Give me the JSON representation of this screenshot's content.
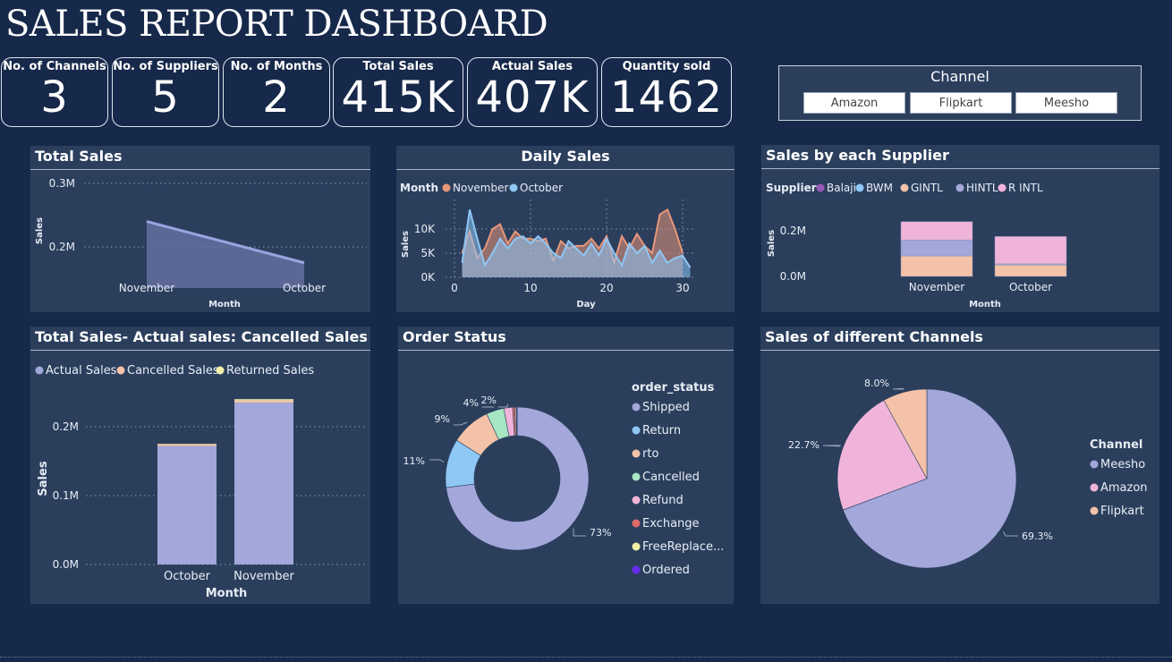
{
  "title": "SALES REPORT DASHBOARD",
  "cards": [
    {
      "label": "No. of Channels",
      "value": "3"
    },
    {
      "label": "No. of Suppliers",
      "value": "5"
    },
    {
      "label": "No. of Months",
      "value": "2"
    },
    {
      "label": "Total Sales",
      "value": "415K"
    },
    {
      "label": "Actual Sales",
      "value": "407K"
    },
    {
      "label": "Quantity sold",
      "value": "1462"
    }
  ],
  "slicer": {
    "title": "Channel",
    "options": [
      "Amazon",
      "Flipkart",
      "Meesho"
    ]
  },
  "colors": {
    "november": "#e8967a",
    "october": "#8fc7f5",
    "area": "#6470a0",
    "bar": "#a3a7da",
    "balaji": "#9b59b6",
    "bwm": "#8fc7f5",
    "gintl": "#f4c2a8",
    "hintl": "#a3a7da",
    "rintl": "#f0b4da",
    "shipped": "#a3a7da",
    "return": "#8fc7f5",
    "rto": "#f4c2a8",
    "cancelled": "#a7e6c3",
    "refund": "#f0b4da",
    "exchange": "#e06a6a",
    "freereplace": "#f2f0a8",
    "ordered": "#6a2cf0"
  },
  "chart_data": [
    {
      "id": "total-sales",
      "type": "area",
      "title": "Total Sales",
      "xlabel": "Month",
      "ylabel": "Sales",
      "categories": [
        "November",
        "October"
      ],
      "values": [
        240000,
        175000
      ],
      "y_ticks": [
        "0.2M",
        "0.3M"
      ],
      "ylim": [
        150000,
        300000
      ],
      "grid": true
    },
    {
      "id": "daily-sales",
      "type": "area",
      "title": "Daily Sales",
      "xlabel": "Day",
      "ylabel": "Sales",
      "legend_title": "Month",
      "x_ticks": [
        "0",
        "10",
        "20",
        "30"
      ],
      "y_ticks": [
        "0K",
        "5K",
        "10K"
      ],
      "ylim": [
        0,
        15000
      ],
      "xlim": [
        0,
        32
      ],
      "series": [
        {
          "name": "November",
          "x": [
            1,
            2,
            3,
            4,
            5,
            6,
            7,
            8,
            9,
            10,
            11,
            12,
            13,
            14,
            15,
            16,
            17,
            18,
            19,
            20,
            21,
            22,
            23,
            24,
            25,
            26,
            27,
            28,
            29,
            30
          ],
          "values": [
            5000,
            9500,
            4000,
            6000,
            10000,
            11000,
            7000,
            9500,
            8000,
            8000,
            7500,
            8000,
            3500,
            7500,
            6000,
            6500,
            6500,
            8000,
            6000,
            8500,
            3000,
            8500,
            6000,
            9000,
            6500,
            5000,
            13000,
            14000,
            10000,
            5000
          ]
        },
        {
          "name": "October",
          "x": [
            1,
            2,
            3,
            4,
            5,
            6,
            7,
            8,
            9,
            10,
            11,
            12,
            13,
            14,
            15,
            16,
            17,
            18,
            19,
            20,
            21,
            22,
            23,
            24,
            25,
            26,
            27,
            28,
            29,
            30,
            31
          ],
          "values": [
            3000,
            14000,
            8000,
            2500,
            5000,
            8000,
            6000,
            8000,
            8500,
            7000,
            8500,
            7000,
            5000,
            4000,
            7500,
            6000,
            4500,
            7000,
            4500,
            8000,
            5000,
            2500,
            7000,
            5000,
            6500,
            3000,
            5500,
            3000,
            4000,
            4500,
            2000
          ]
        }
      ],
      "grid": true
    },
    {
      "id": "sales-by-supplier",
      "type": "bar",
      "title": "Sales by each Supplier",
      "xlabel": "Month",
      "ylabel": "Sales",
      "legend_title": "Supplier",
      "categories": [
        "November",
        "October"
      ],
      "y_ticks": [
        "0.0M",
        "0.2M"
      ],
      "ylim": [
        0,
        250000
      ],
      "series": [
        {
          "name": "Balaji",
          "values": [
            0,
            0
          ]
        },
        {
          "name": "BWM",
          "values": [
            0,
            0
          ]
        },
        {
          "name": "GINTL",
          "values": [
            90000,
            50000
          ]
        },
        {
          "name": "HINTL",
          "values": [
            70000,
            5000
          ]
        },
        {
          "name": "R INTL",
          "values": [
            80000,
            120000
          ]
        }
      ]
    },
    {
      "id": "cancelled-sales",
      "type": "bar",
      "title": "Total Sales- Actual sales: Cancelled Sales",
      "xlabel": "Month",
      "ylabel": "Sales",
      "categories": [
        "October",
        "November"
      ],
      "y_ticks": [
        "0.0M",
        "0.1M",
        "0.2M"
      ],
      "ylim": [
        0,
        260000
      ],
      "series": [
        {
          "name": "Actual Sales",
          "values": [
            172000,
            235000
          ]
        },
        {
          "name": "Cancelled Sales",
          "values": [
            2000,
            3000
          ]
        },
        {
          "name": "Returned Sales",
          "values": [
            1000,
            2000
          ]
        }
      ],
      "grid": true
    },
    {
      "id": "order-status",
      "type": "pie",
      "title": "Order Status",
      "legend_title": "order_status",
      "labels": [
        "Shipped",
        "Return",
        "rto",
        "Cancelled",
        "Refund",
        "Exchange",
        "FreeReplace...",
        "Ordered"
      ],
      "values": [
        73,
        11,
        9,
        4,
        2,
        0.5,
        0.3,
        0.2
      ],
      "data_labels": [
        "73%",
        "11%",
        "9%",
        "4%",
        "2%",
        "",
        "",
        ""
      ]
    },
    {
      "id": "channel-sales",
      "type": "pie",
      "title": "Sales of different Channels",
      "legend_title": "Channel",
      "labels": [
        "Meesho",
        "Amazon",
        "Flipkart"
      ],
      "values": [
        69.3,
        22.7,
        8.0
      ],
      "data_labels": [
        "69.3%",
        "22.7%",
        "8.0%"
      ]
    }
  ]
}
